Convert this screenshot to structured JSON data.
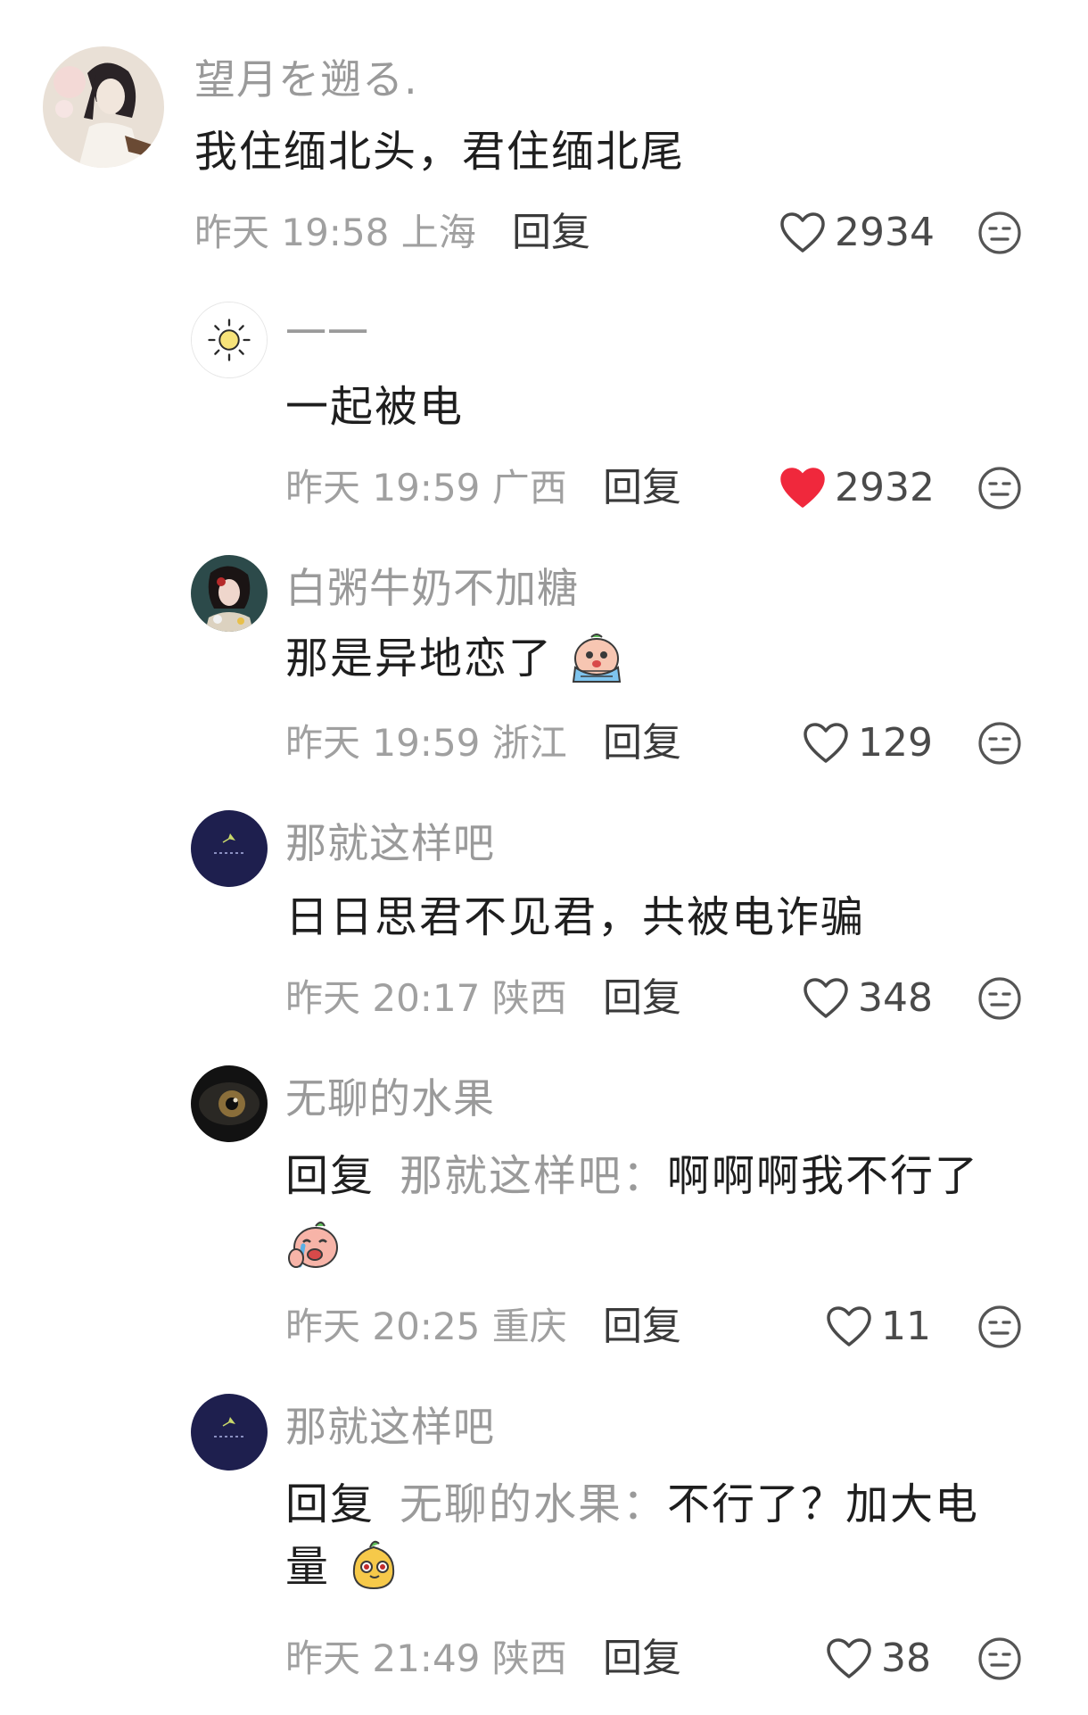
{
  "comments": [
    {
      "username": "望月を遡る.",
      "text": "我住缅北头，君住缅北尾",
      "time": "昨天 19:58 上海",
      "reply_label": "回复",
      "likes": "2934",
      "liked": false
    },
    {
      "username": "一一",
      "text": "一起被电",
      "time": "昨天 19:59 广西",
      "reply_label": "回复",
      "likes": "2932",
      "liked": true
    },
    {
      "username": "白粥牛奶不加糖",
      "text": "那是异地恋了",
      "time": "昨天 19:59 浙江",
      "reply_label": "回复",
      "likes": "129",
      "liked": false
    },
    {
      "username": "那就这样吧",
      "text": "日日思君不见君，共被电诈骗",
      "time": "昨天 20:17 陕西",
      "reply_label": "回复",
      "likes": "348",
      "liked": false
    },
    {
      "username": "无聊的水果",
      "reply_prefix": "回复",
      "reply_to": "那就这样吧：",
      "text": "啊啊啊我不行了",
      "time": "昨天 20:25 重庆",
      "reply_label": "回复",
      "likes": "11",
      "liked": false
    },
    {
      "username": "那就这样吧",
      "reply_prefix": "回复",
      "reply_to": "无聊的水果：",
      "text": "不行了？加大电",
      "text_line2": "量",
      "time": "昨天 21:49 陕西",
      "reply_label": "回复",
      "likes": "38",
      "liked": false
    }
  ],
  "colors": {
    "liked_heart": "#f0283c",
    "muted_text": "#9a9a9a"
  },
  "icons": [
    "heart-icon",
    "dislike-face-icon",
    "crying-emoji",
    "sob-emoji",
    "smug-emoji"
  ]
}
